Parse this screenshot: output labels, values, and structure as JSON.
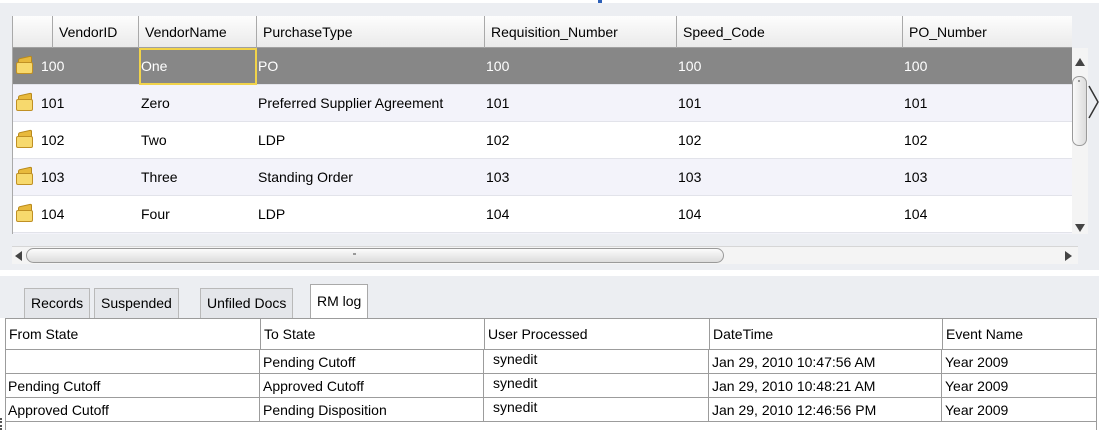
{
  "vendor_grid": {
    "columns": [
      "VendorID",
      "VendorName",
      "PurchaseType",
      "Requisition_Number",
      "Speed_Code",
      "PO_Number"
    ],
    "rows": [
      {
        "vendor_id": "100",
        "vendor_name": "One",
        "purchase_type": "PO",
        "requisition_number": "100",
        "speed_code": "100",
        "po_number": "100"
      },
      {
        "vendor_id": "101",
        "vendor_name": "Zero",
        "purchase_type": "Preferred Supplier Agreement",
        "requisition_number": "101",
        "speed_code": "101",
        "po_number": "101"
      },
      {
        "vendor_id": "102",
        "vendor_name": "Two",
        "purchase_type": "LDP",
        "requisition_number": "102",
        "speed_code": "102",
        "po_number": "102"
      },
      {
        "vendor_id": "103",
        "vendor_name": "Three",
        "purchase_type": "Standing Order",
        "requisition_number": "103",
        "speed_code": "103",
        "po_number": "103"
      },
      {
        "vendor_id": "104",
        "vendor_name": "Four",
        "purchase_type": "LDP",
        "requisition_number": "104",
        "speed_code": "104",
        "po_number": "104"
      }
    ],
    "selected_row_color": "#878787",
    "focus_cell_color": "#f1d34a",
    "row_icon": "folder-icon"
  },
  "tabs": {
    "items": [
      "Records",
      "Suspended",
      "Unfiled Docs",
      "RM log"
    ],
    "active": "RM log"
  },
  "rm_log": {
    "columns": [
      "From State",
      "To State",
      "User Processed",
      "DateTime",
      "Event Name"
    ],
    "rows": [
      {
        "from_state": "",
        "to_state": "Pending Cutoff",
        "user_processed": "synedit",
        "datetime": "Jan 29, 2010 10:47:56 AM",
        "event_name": "Year 2009"
      },
      {
        "from_state": "Pending Cutoff",
        "to_state": "Approved Cutoff",
        "user_processed": "synedit",
        "datetime": "Jan 29, 2010 10:48:21 AM",
        "event_name": "Year 2009"
      },
      {
        "from_state": "Approved Cutoff",
        "to_state": "Pending Disposition",
        "user_processed": "synedit",
        "datetime": "Jan 29, 2010 12:46:56 PM",
        "event_name": "Year 2009"
      }
    ]
  }
}
